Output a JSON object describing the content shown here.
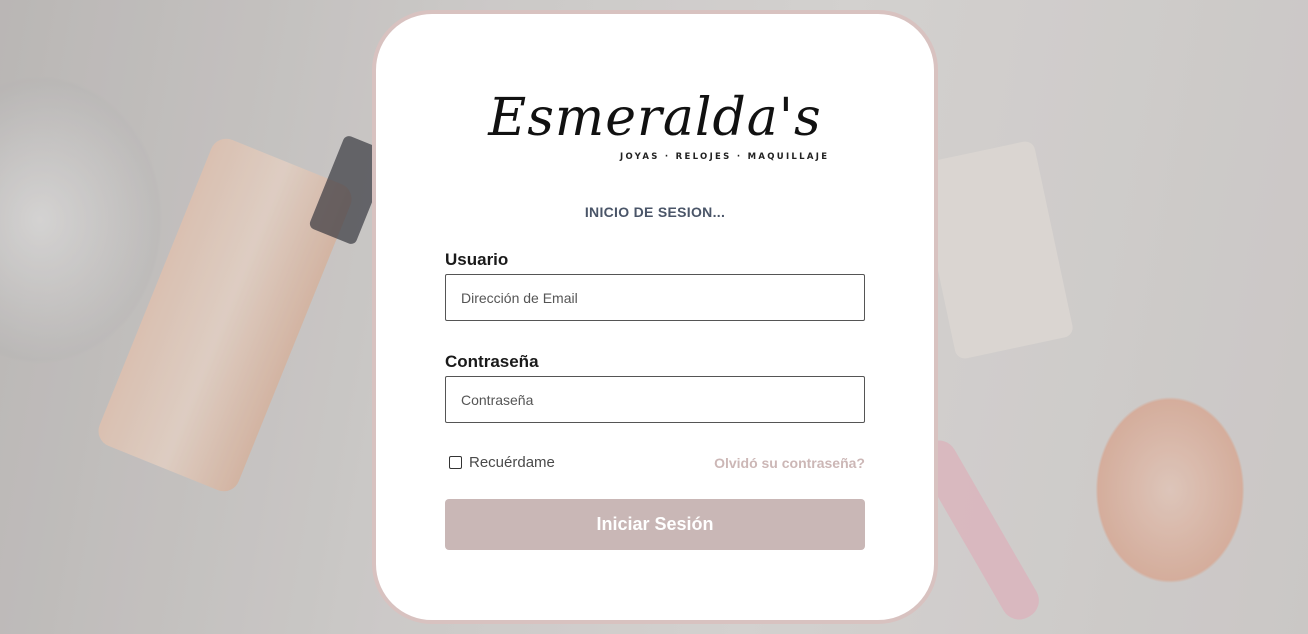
{
  "brand": {
    "name": "Esmeralda's",
    "tagline": "JOYAS · RELOJES · MAQUILLAJE"
  },
  "form": {
    "title": "INICIO DE SESION...",
    "username_label": "Usuario",
    "username_placeholder": "Dirección de Email",
    "password_label": "Contraseña",
    "password_placeholder": "Contraseña",
    "remember_label": "Recuérdame",
    "remember_checked": false,
    "forgot_link": "Olvidó su contraseña?",
    "submit_label": "Iniciar Sesión"
  },
  "colors": {
    "accent": "#c9b7b6",
    "card_border": "#d8c2c0",
    "link": "#ccb7b6"
  }
}
